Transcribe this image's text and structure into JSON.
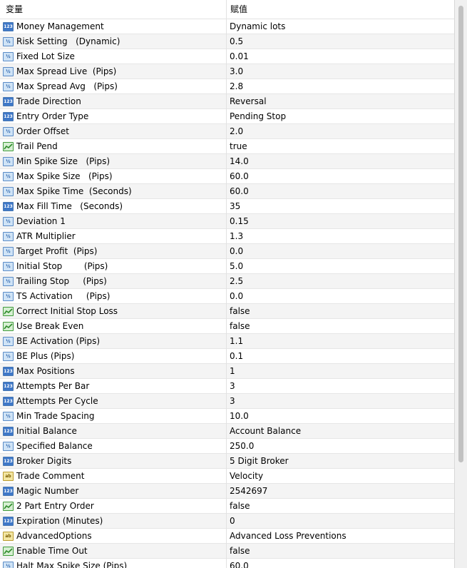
{
  "header": {
    "name": "变量",
    "value": "赋值"
  },
  "rows": [
    {
      "type": "int",
      "name": "Money Management",
      "value": "Dynamic lots"
    },
    {
      "type": "dbl",
      "name": "Risk Setting   (Dynamic)",
      "value": "0.5"
    },
    {
      "type": "dbl",
      "name": "Fixed Lot Size",
      "value": "0.01"
    },
    {
      "type": "dbl",
      "name": "Max Spread Live  (Pips)",
      "value": "3.0"
    },
    {
      "type": "dbl",
      "name": "Max Spread Avg   (Pips)",
      "value": "2.8"
    },
    {
      "type": "int",
      "name": "Trade Direction",
      "value": "Reversal"
    },
    {
      "type": "int",
      "name": "Entry Order Type",
      "value": "Pending Stop"
    },
    {
      "type": "dbl",
      "name": "Order Offset",
      "value": "2.0"
    },
    {
      "type": "bool",
      "name": "Trail Pend",
      "value": "true"
    },
    {
      "type": "dbl",
      "name": "Min Spike Size   (Pips)",
      "value": "14.0"
    },
    {
      "type": "dbl",
      "name": "Max Spike Size   (Pips)",
      "value": "60.0"
    },
    {
      "type": "dbl",
      "name": "Max Spike Time  (Seconds)",
      "value": "60.0"
    },
    {
      "type": "int",
      "name": "Max Fill Time   (Seconds)",
      "value": "35"
    },
    {
      "type": "dbl",
      "name": "Deviation 1",
      "value": "0.15"
    },
    {
      "type": "dbl",
      "name": "ATR Multiplier",
      "value": "1.3"
    },
    {
      "type": "dbl",
      "name": "Target Profit  (Pips)",
      "value": "0.0"
    },
    {
      "type": "dbl",
      "name": "Initial Stop        (Pips)",
      "value": "5.0"
    },
    {
      "type": "dbl",
      "name": "Trailing Stop     (Pips)",
      "value": "2.5"
    },
    {
      "type": "dbl",
      "name": "TS Activation     (Pips)",
      "value": "0.0"
    },
    {
      "type": "bool",
      "name": "Correct Initial Stop Loss",
      "value": "false"
    },
    {
      "type": "bool",
      "name": "Use Break Even",
      "value": "false"
    },
    {
      "type": "dbl",
      "name": "BE Activation (Pips)",
      "value": "1.1"
    },
    {
      "type": "dbl",
      "name": "BE Plus (Pips)",
      "value": "0.1"
    },
    {
      "type": "int",
      "name": "Max Positions",
      "value": "1"
    },
    {
      "type": "int",
      "name": "Attempts Per Bar",
      "value": "3"
    },
    {
      "type": "int",
      "name": "Attempts Per Cycle",
      "value": "3"
    },
    {
      "type": "dbl",
      "name": "Min Trade Spacing",
      "value": "10.0"
    },
    {
      "type": "int",
      "name": "Initial Balance",
      "value": "Account Balance"
    },
    {
      "type": "dbl",
      "name": "Specified Balance",
      "value": "250.0"
    },
    {
      "type": "int",
      "name": "Broker Digits",
      "value": "5 Digit Broker"
    },
    {
      "type": "str",
      "name": "Trade Comment",
      "value": "Velocity"
    },
    {
      "type": "int",
      "name": "Magic Number",
      "value": "2542697"
    },
    {
      "type": "bool",
      "name": "2 Part Entry Order",
      "value": "false"
    },
    {
      "type": "int",
      "name": "Expiration (Minutes)",
      "value": "0"
    },
    {
      "type": "str",
      "name": "AdvancedOptions",
      "value": "Advanced Loss Preventions"
    },
    {
      "type": "bool",
      "name": "Enable Time Out",
      "value": "false"
    },
    {
      "type": "dbl",
      "name": "Halt Max Spike Size (Pips)",
      "value": "60.0"
    }
  ],
  "icons": {
    "int": {
      "name": "integer-type-icon",
      "glyph": "123"
    },
    "dbl": {
      "name": "double-type-icon",
      "glyph": "½"
    },
    "bool": {
      "name": "bool-type-icon",
      "glyph": ""
    },
    "str": {
      "name": "string-type-icon",
      "glyph": "ab"
    }
  }
}
